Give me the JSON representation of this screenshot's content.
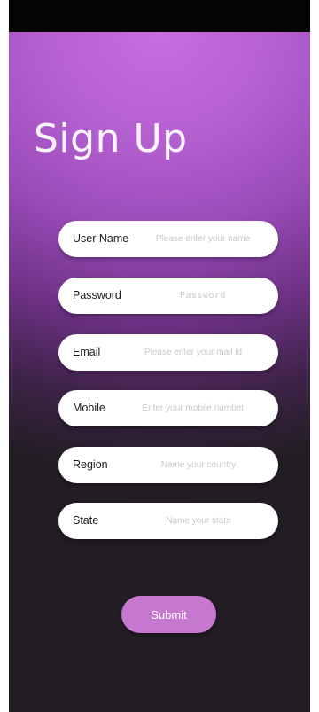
{
  "screen": {
    "title": "Sign Up"
  },
  "form": {
    "fields": [
      {
        "label": "User Name",
        "placeholder": "Please enter your name"
      },
      {
        "label": "Password",
        "placeholder": "Password"
      },
      {
        "label": "Email",
        "placeholder": "Please enter your mail id"
      },
      {
        "label": "Mobile",
        "placeholder": "Enter your mobile number"
      },
      {
        "label": "Region",
        "placeholder": "Name your country"
      },
      {
        "label": "State",
        "placeholder": "Name your state"
      }
    ],
    "submit_label": "Submit"
  },
  "colors": {
    "gradient_top": "#c86ee0",
    "gradient_bottom": "#221c24",
    "submit_button": "#c677cf",
    "status_bar": "#050505"
  }
}
